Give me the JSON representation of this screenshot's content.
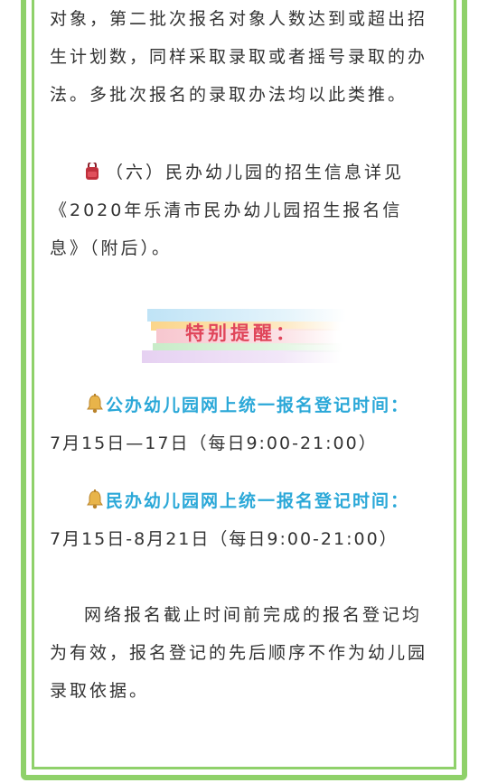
{
  "paragraphs": {
    "p1_lines": [
      "对象，第二批次报名对象人数达到或超出招",
      "生计划数，同样采取录取或者摇号录取的办",
      "法。多批次报名的录取办法均以此类推。"
    ],
    "p2_lines": [
      "（六）民办幼儿园的招生信息详见",
      "《2020年乐清市民办幼儿园招生报名信",
      "息》（附后）。"
    ]
  },
  "reminder": {
    "title": "特别提醒："
  },
  "notices": [
    {
      "heading": "公办幼儿园网上统一报名登记时间：",
      "time": "7月15日—17日（每日9:00-21:00）"
    },
    {
      "heading": "民办幼儿园网上统一报名登记时间：",
      "time": "7月15日-8月21日（每日9:00-21:00）"
    }
  ],
  "closing": {
    "lines": [
      "网络报名截止时间前完成的报名登记均",
      "为有效，报名登记的先后顺序不作为幼儿园",
      "录取依据。"
    ]
  },
  "colors": {
    "frame": "#8fd16a",
    "heading": "#2ba8d8",
    "reminder": "#e0455a",
    "text": "#333333"
  }
}
